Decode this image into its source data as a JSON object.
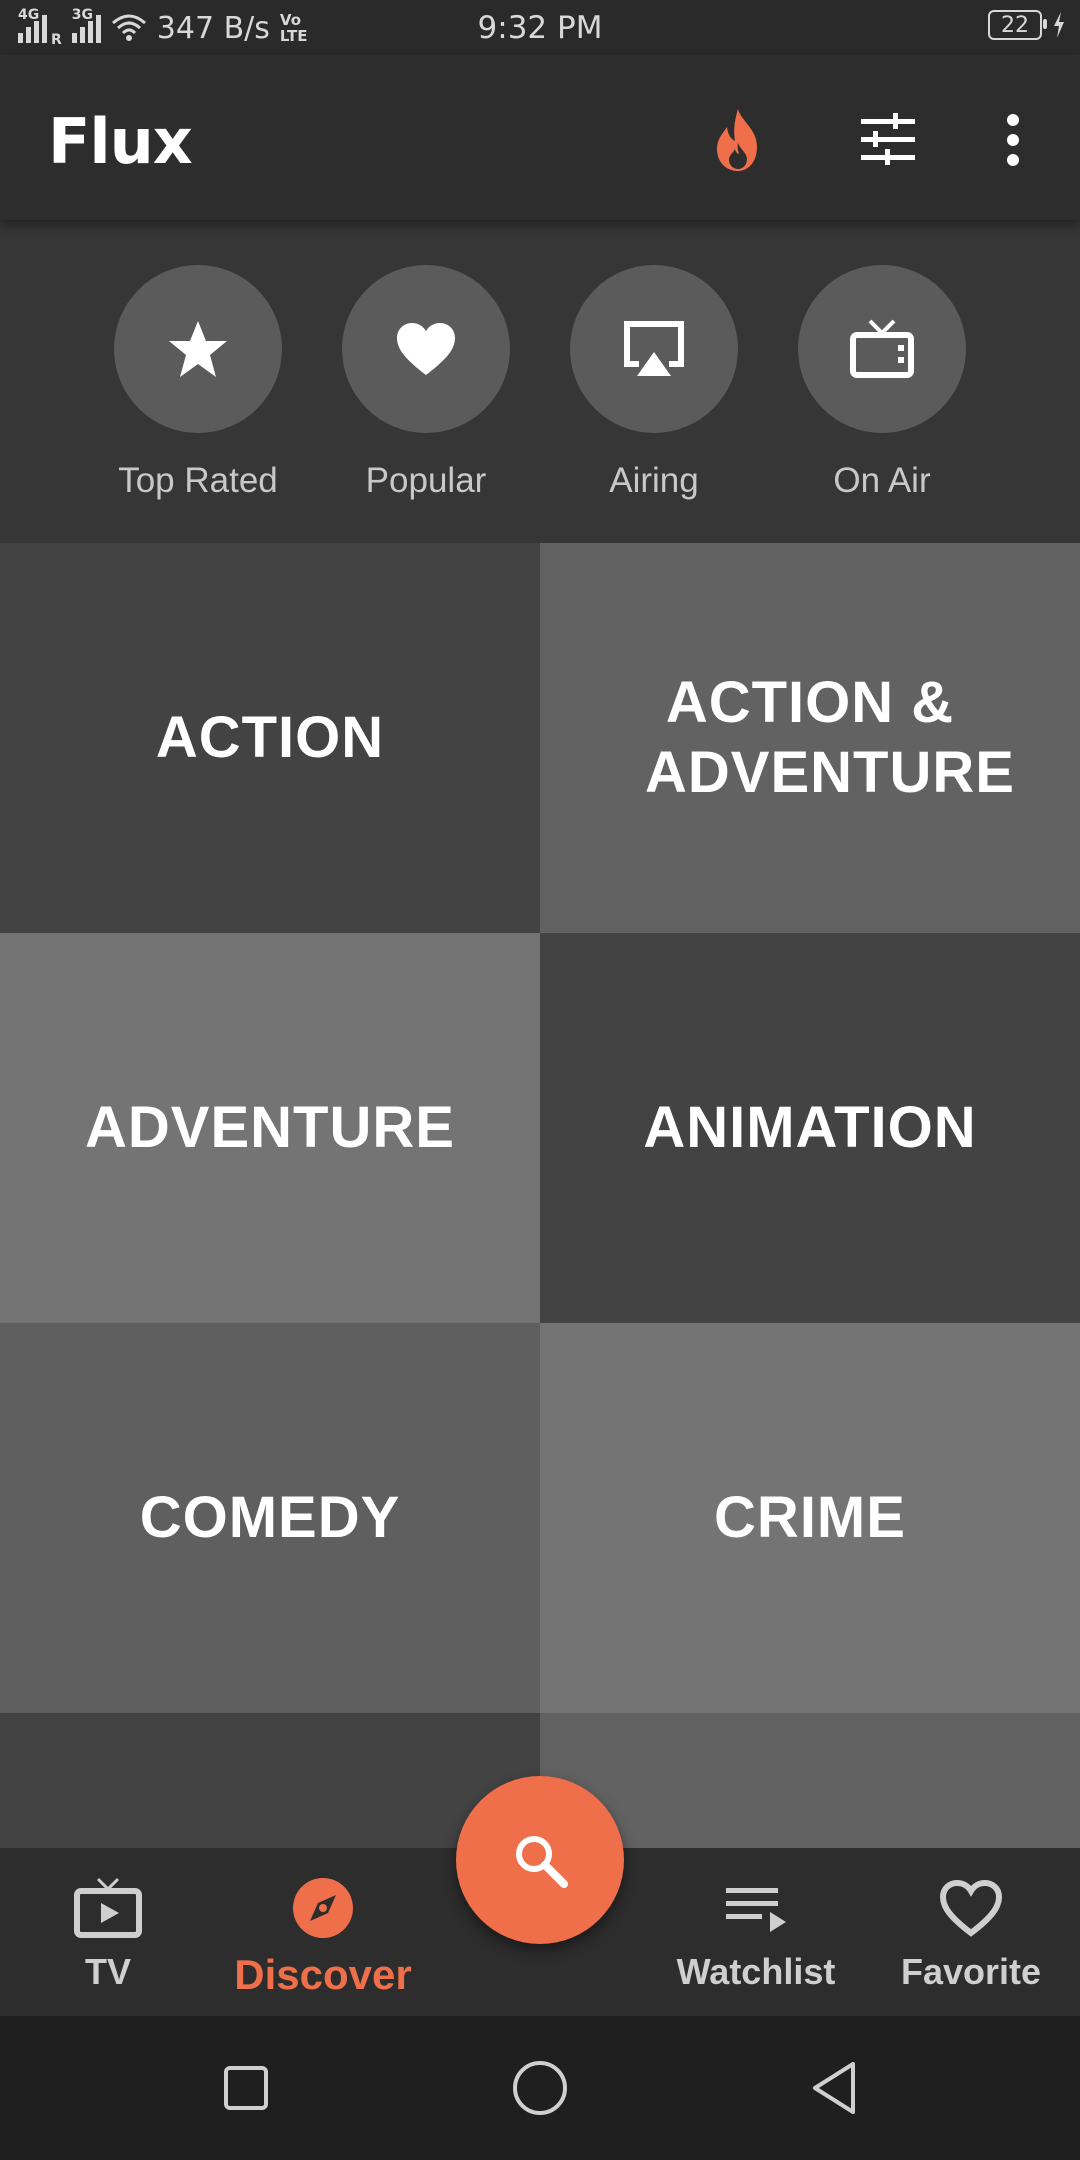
{
  "status_bar": {
    "signal1": "4G",
    "signal1_sub": "R",
    "signal2": "3G",
    "network_speed": "347 B/s",
    "volte": "Vo LTE",
    "time": "9:32 PM",
    "battery": "22"
  },
  "app_bar": {
    "title": "Flux",
    "icons": [
      "fire-icon",
      "filter-sliders-icon",
      "more-vert-icon"
    ]
  },
  "quick_links": [
    {
      "label": "Top Rated",
      "icon": "star-icon"
    },
    {
      "label": "Popular",
      "icon": "heart-icon"
    },
    {
      "label": "Airing",
      "icon": "airplay-icon"
    },
    {
      "label": "On Air",
      "icon": "tv-icon"
    }
  ],
  "genres": [
    {
      "label": "ACTION",
      "color": "#434343"
    },
    {
      "label": "ACTION & ADVENTURE",
      "color": "#626262"
    },
    {
      "label": "ADVENTURE",
      "color": "#747474"
    },
    {
      "label": "ANIMATION",
      "color": "#434343"
    },
    {
      "label": "COMEDY",
      "color": "#5f5f5f"
    },
    {
      "label": "CRIME",
      "color": "#747474"
    },
    {
      "label": "",
      "color": "#434343"
    },
    {
      "label": "",
      "color": "#626262"
    }
  ],
  "bottom_nav": {
    "items": [
      {
        "label": "TV",
        "icon": "tv-play-icon"
      },
      {
        "label": "Discover",
        "icon": "compass-icon",
        "active": true
      },
      {
        "label": "Watchlist",
        "icon": "playlist-icon"
      },
      {
        "label": "Favorite",
        "icon": "heart-outline-icon"
      }
    ],
    "fab_icon": "search-icon"
  },
  "colors": {
    "accent": "#ee6f4a",
    "appbar": "#2d2d2d",
    "background": "#363636"
  }
}
